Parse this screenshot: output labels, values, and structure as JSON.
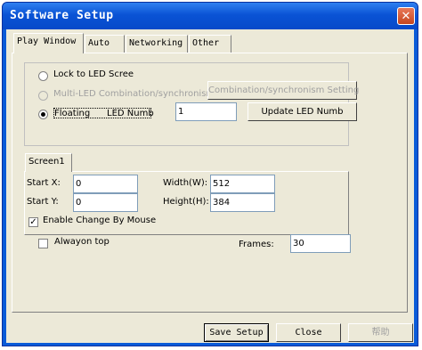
{
  "window": {
    "title": "Software Setup",
    "close_glyph": "✕"
  },
  "tabs": [
    {
      "label": "Play Window",
      "active": true
    },
    {
      "label": "Auto"
    },
    {
      "label": "Networking"
    },
    {
      "label": "Other"
    }
  ],
  "mode": {
    "lock_label": "Lock to LED Scree",
    "multi_label": "Multi-LED Combination/synchronism",
    "combination_button": "Combination/synchronism Setting",
    "floating_label": "Floating",
    "led_numb_label": "LED Numb",
    "led_numb_value": "1",
    "update_button": "Update LED Numb",
    "selected": "Floating"
  },
  "screen_tab": {
    "label": "Screen1"
  },
  "screen": {
    "start_x_label": "Start X:",
    "start_x_value": "0",
    "start_y_label": "Start Y:",
    "start_y_value": "0",
    "width_label": "Width(W):",
    "width_value": "512",
    "height_label": "Height(H):",
    "height_value": "384",
    "enable_mouse_label": "Enable Change By Mouse",
    "enable_mouse_checked": true,
    "check_glyph": "✓"
  },
  "options": {
    "always_on_top_label": "Alwayon top",
    "always_on_top_checked": false,
    "frames_label": "Frames:",
    "frames_value": "30"
  },
  "buttons": {
    "save": "Save Setup",
    "close": "Close",
    "help": "帮助"
  },
  "colors": {
    "titlebar": "#0A53D5",
    "face": "#ECE9D8",
    "close": "#C6461F",
    "disabled_text": "#A0A0A0"
  }
}
